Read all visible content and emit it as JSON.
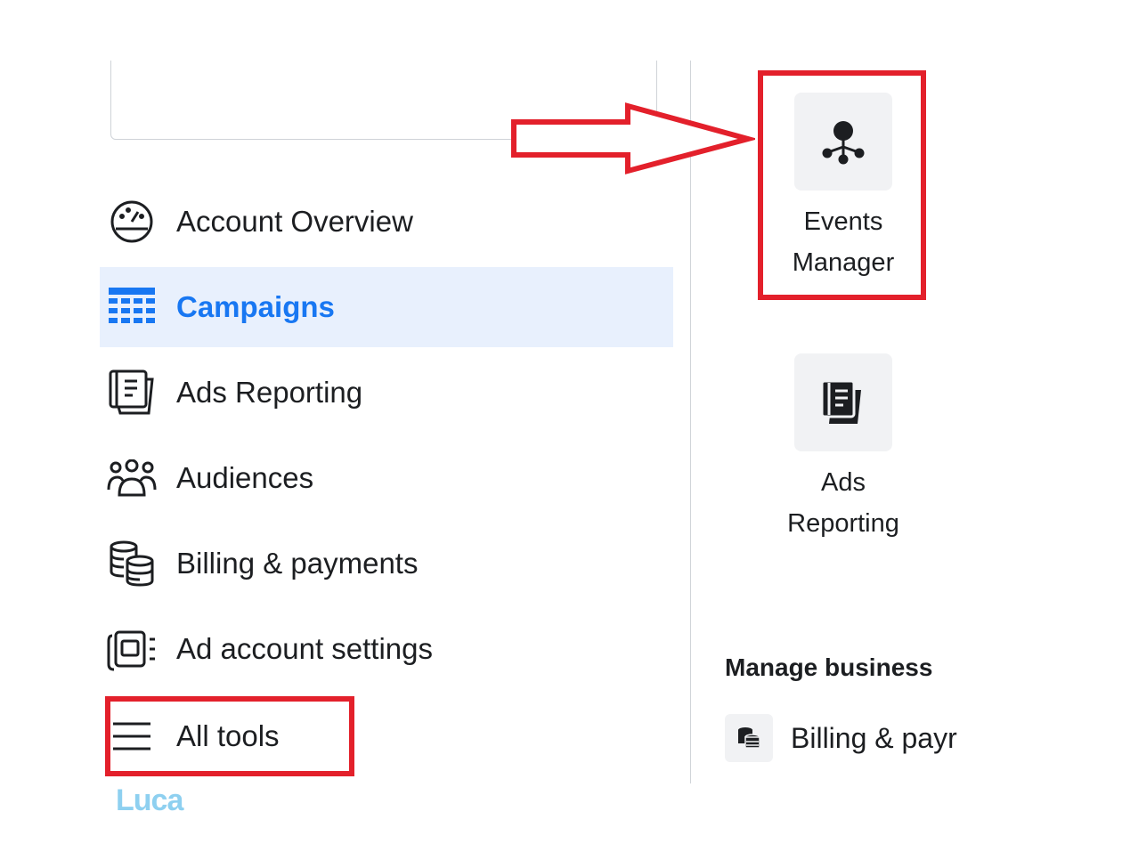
{
  "nav": {
    "items": [
      {
        "label": "Account Overview",
        "icon": "gauge-icon"
      },
      {
        "label": "Campaigns",
        "icon": "table-icon",
        "active": true
      },
      {
        "label": "Ads Reporting",
        "icon": "report-icon"
      },
      {
        "label": "Audiences",
        "icon": "people-icon"
      },
      {
        "label": "Billing & payments",
        "icon": "coins-icon"
      },
      {
        "label": "Ad account settings",
        "icon": "settings-card-icon"
      },
      {
        "label": "All tools",
        "icon": "hamburger-icon"
      }
    ]
  },
  "tools": {
    "events_manager": {
      "line1": "Events",
      "line2": "Manager",
      "icon": "events-network-icon"
    },
    "ads_reporting": {
      "line1": "Ads",
      "line2": "Reporting",
      "icon": "report-icon"
    }
  },
  "manage_business": {
    "title": "Manage business",
    "billing_label": "Billing & payr"
  },
  "logo_text": "Luca",
  "colors": {
    "accent": "#1877f2",
    "highlight": "#e3202b",
    "active_bg": "#e8f0fd"
  }
}
